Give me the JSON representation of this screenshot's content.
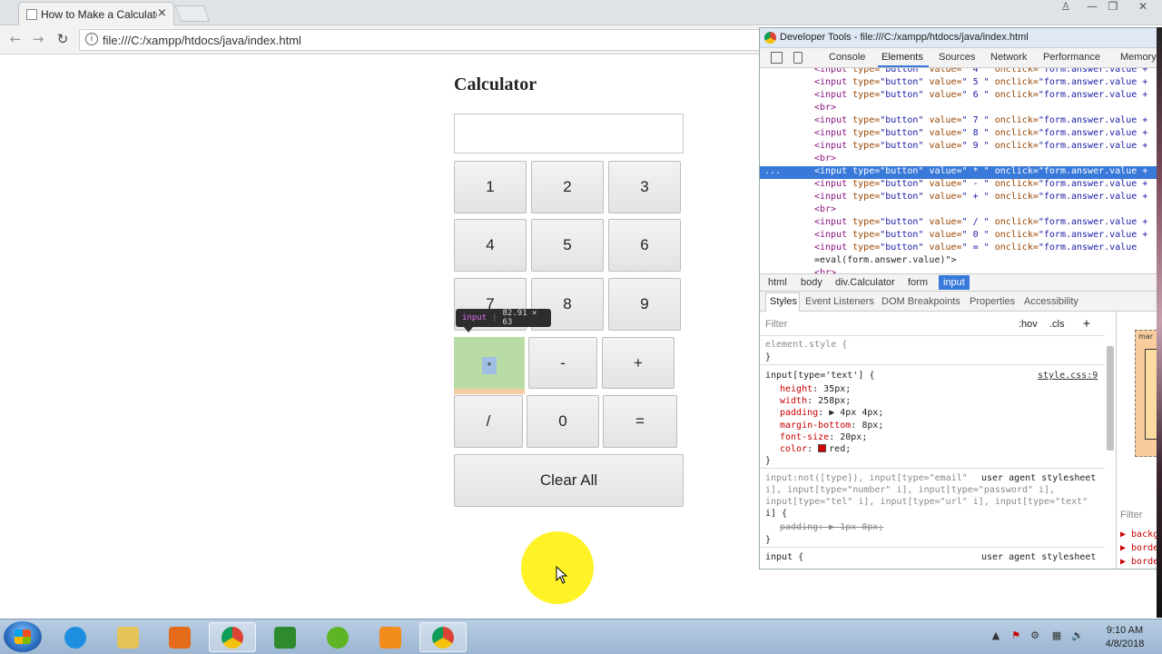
{
  "browser": {
    "tab_title": "How to Make a Calculator",
    "tab_close": "×",
    "url": "file:///C:/xampp/htdocs/java/index.html",
    "back": "←",
    "forward": "→",
    "reload": "↻",
    "info": "i"
  },
  "window_controls": {
    "user": "♙",
    "minimize": "—",
    "maximize": "❐",
    "close": "✕"
  },
  "calculator": {
    "title": "Calculator",
    "answer_value": "",
    "keys": [
      "1",
      "2",
      "3",
      "4",
      "5",
      "6",
      "7",
      "8",
      "9",
      "*",
      "-",
      "+",
      "/",
      "0",
      "="
    ],
    "clear_label": "Clear All"
  },
  "inspect_tooltip": {
    "tag": "input",
    "separator": "|",
    "dims": "82.91 × 63"
  },
  "devtools": {
    "title": "Developer Tools - file:///C:/xampp/htdocs/java/index.html",
    "tabs": [
      "Console",
      "Elements",
      "Sources",
      "Network",
      "Performance",
      "Memory"
    ],
    "active_tab": "Elements",
    "dom_lines": [
      {
        "tag": "<input",
        "attr1": " type=",
        "val1": "\"button\"",
        "attr2": " value=",
        "val2": "\" 4 \"",
        "attr3": " onclick=",
        "val3": "\"form.answer.value +"
      },
      {
        "tag": "<input",
        "attr1": " type=",
        "val1": "\"button\"",
        "attr2": " value=",
        "val2": "\" 5 \"",
        "attr3": " onclick=",
        "val3": "\"form.answer.value +"
      },
      {
        "tag": "<input",
        "attr1": " type=",
        "val1": "\"button\"",
        "attr2": " value=",
        "val2": "\" 6 \"",
        "attr3": " onclick=",
        "val3": "\"form.answer.value +"
      },
      {
        "tag": "<br>",
        "attr1": "",
        "val1": "",
        "attr2": "",
        "val2": "",
        "attr3": "",
        "val3": ""
      },
      {
        "tag": "<input",
        "attr1": " type=",
        "val1": "\"button\"",
        "attr2": " value=",
        "val2": "\" 7 \"",
        "attr3": " onclick=",
        "val3": "\"form.answer.value +"
      },
      {
        "tag": "<input",
        "attr1": " type=",
        "val1": "\"button\"",
        "attr2": " value=",
        "val2": "\" 8 \"",
        "attr3": " onclick=",
        "val3": "\"form.answer.value +"
      },
      {
        "tag": "<input",
        "attr1": " type=",
        "val1": "\"button\"",
        "attr2": " value=",
        "val2": "\" 9 \"",
        "attr3": " onclick=",
        "val3": "\"form.answer.value +"
      },
      {
        "tag": "<br>",
        "attr1": "",
        "val1": "",
        "attr2": "",
        "val2": "",
        "attr3": "",
        "val3": ""
      },
      {
        "tag": "<input",
        "attr1": " type=",
        "val1": "\"button\"",
        "attr2": " value=",
        "val2": "\" * \"",
        "attr3": " onclick=",
        "val3": "\"form.answer.value +"
      },
      {
        "tag": "<input",
        "attr1": " type=",
        "val1": "\"button\"",
        "attr2": " value=",
        "val2": "\" - \"",
        "attr3": " onclick=",
        "val3": "\"form.answer.value +"
      },
      {
        "tag": "<input",
        "attr1": " type=",
        "val1": "\"button\"",
        "attr2": " value=",
        "val2": "\" + \"",
        "attr3": " onclick=",
        "val3": "\"form.answer.value +"
      },
      {
        "tag": "<br>",
        "attr1": "",
        "val1": "",
        "attr2": "",
        "val2": "",
        "attr3": "",
        "val3": ""
      },
      {
        "tag": "<input",
        "attr1": " type=",
        "val1": "\"button\"",
        "attr2": " value=",
        "val2": "\" / \"",
        "attr3": " onclick=",
        "val3": "\"form.answer.value +"
      },
      {
        "tag": "<input",
        "attr1": " type=",
        "val1": "\"button\"",
        "attr2": " value=",
        "val2": "\" 0 \"",
        "attr3": " onclick=",
        "val3": "\"form.answer.value +"
      },
      {
        "tag": "<input",
        "attr1": " type=",
        "val1": "\"button\"",
        "attr2": " value=",
        "val2": "\" = \"",
        "attr3": " onclick=",
        "val3": "\"form.answer.value"
      },
      {
        "tag": "=eval(form.answer.value)\">",
        "attr1": "",
        "val1": "",
        "attr2": "",
        "val2": "",
        "attr3": "",
        "val3": ""
      },
      {
        "tag": "<br>",
        "attr1": "",
        "val1": "",
        "attr2": "",
        "val2": "",
        "attr3": "",
        "val3": ""
      }
    ],
    "selected_dom_index": 8,
    "selected_marker": "...",
    "breadcrumb": [
      "html",
      "body",
      "div.Calculator",
      "form",
      "input"
    ],
    "styles_tabs": [
      "Styles",
      "Event Listeners",
      "DOM Breakpoints",
      "Properties",
      "Accessibility"
    ],
    "styles": {
      "filter_placeholder": "Filter",
      "hov": ":hov",
      "cls": ".cls",
      "plus": "+",
      "element_style": "element.style {",
      "close_brace": "}",
      "rule_selector": "input[type='text'] {",
      "rule_source": "style.css:9",
      "props": [
        {
          "name": "height",
          "value": "35px;"
        },
        {
          "name": "width",
          "value": "258px;"
        },
        {
          "name": "padding",
          "value": "▶ 4px 4px;"
        },
        {
          "name": "margin-bottom",
          "value": "8px;"
        },
        {
          "name": "font-size",
          "value": "20px;"
        },
        {
          "name": "color",
          "value": "red;"
        }
      ],
      "ua_selector_1": "input:not([type]), input[type=\"email\"",
      "ua_label": "user agent stylesheet",
      "ua_selector_2": "i], input[type=\"number\" i], input[type=\"password\" i],",
      "ua_selector_3": "input[type=\"tel\" i], input[type=\"url\" i], input[type=\"text\"",
      "ua_selector_4": "i] {",
      "ua_struck": "padding: ▶ 1px 0px;",
      "input_selector": "input {",
      "ua_label_2": "user agent stylesheet"
    },
    "computed": {
      "box_label": "mar",
      "filter_placeholder": "Filter",
      "props": [
        "▶ backg",
        "▶ borde",
        "▶ borde",
        "▶ borde",
        "▶ borde"
      ]
    }
  },
  "taskbar": {
    "time": "9:10 AM",
    "date": "4/8/2018",
    "apps": [
      {
        "name": "internet-explorer",
        "color": "#1e8fe0"
      },
      {
        "name": "file-explorer",
        "color": "#e7c45a"
      },
      {
        "name": "media-player",
        "color": "#e46b1a"
      },
      {
        "name": "chrome",
        "color": "#db4437"
      },
      {
        "name": "camtasia",
        "color": "#2d8a2d"
      },
      {
        "name": "utorrent",
        "color": "#5eb524"
      },
      {
        "name": "sublime-text",
        "color": "#f28c1d"
      },
      {
        "name": "chrome-2",
        "color": "#db4437"
      }
    ],
    "tray": [
      "▲",
      "⚑",
      "⚙",
      "▦",
      "🔊"
    ]
  }
}
